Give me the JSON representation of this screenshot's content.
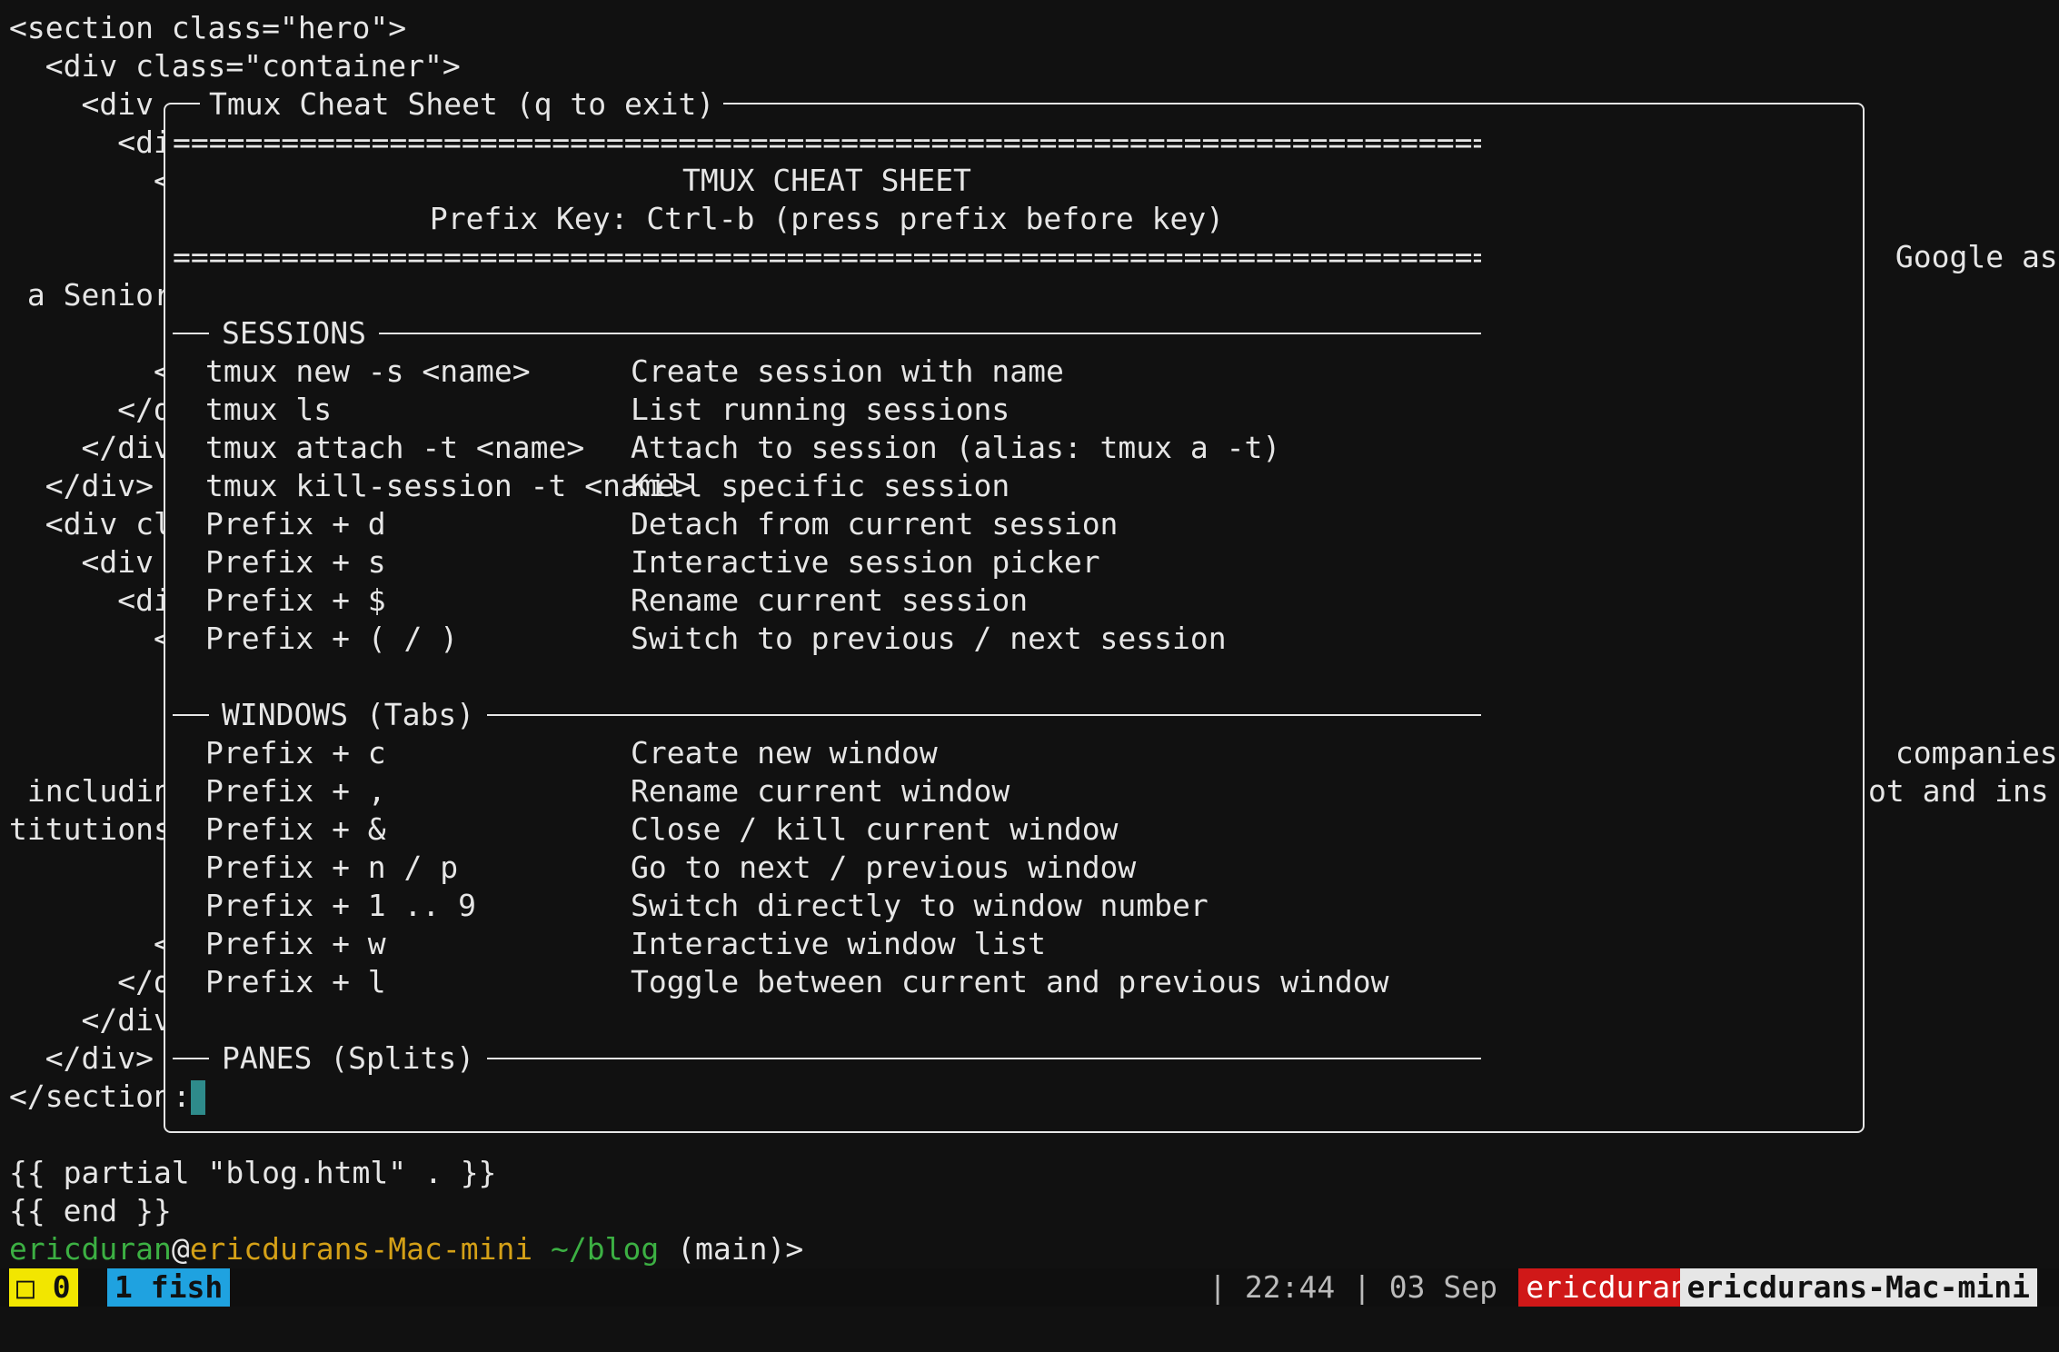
{
  "background_editor": {
    "lines_left": [
      "<section class=\"hero\">",
      "  <div class=\"container\">",
      "    <div",
      "      <di",
      "        <",
      "",
      "",
      " a Senior",
      "",
      "        <",
      "      </d",
      "    </div",
      "  </div> ",
      "  <div cl",
      "    <div ",
      "      <di",
      "        <",
      "",
      "",
      "",
      " includin",
      "titutions",
      "",
      "",
      "        <",
      "      </d",
      "    </div",
      "  </div> ",
      "</section"
    ],
    "right_google": " Google as",
    "right_companies": " companies",
    "right_ot": "ot and ins",
    "after_popup": [
      "{{ partial \"blog.html\" . }}",
      "{{ end }}"
    ]
  },
  "popup": {
    "title": "Tmux Cheat Sheet (q to exit)",
    "separator": "===================================================================================",
    "heading": "TMUX CHEAT SHEET",
    "prefix_line": "Prefix Key: Ctrl-b (press prefix before key)",
    "sections": [
      {
        "title": "SESSIONS",
        "rows": [
          {
            "cmd": "tmux new -s <name>",
            "desc": "Create session with name"
          },
          {
            "cmd": "tmux ls",
            "desc": "List running sessions"
          },
          {
            "cmd": "tmux attach -t <name>",
            "desc": "Attach to session (alias: tmux a -t)"
          },
          {
            "cmd": "tmux kill-session -t <name>",
            "desc": "Kill specific session"
          },
          {
            "cmd": "Prefix + d",
            "desc": "Detach from current session"
          },
          {
            "cmd": "Prefix + s",
            "desc": "Interactive session picker"
          },
          {
            "cmd": "Prefix + $",
            "desc": "Rename current session"
          },
          {
            "cmd": "Prefix + ( / )",
            "desc": "Switch to previous / next session"
          }
        ]
      },
      {
        "title": "WINDOWS (Tabs)",
        "rows": [
          {
            "cmd": "Prefix + c",
            "desc": "Create new window"
          },
          {
            "cmd": "Prefix + ,",
            "desc": "Rename current window"
          },
          {
            "cmd": "Prefix + &",
            "desc": "Close / kill current window"
          },
          {
            "cmd": "Prefix + n / p",
            "desc": "Go to next / previous window"
          },
          {
            "cmd": "Prefix + 1 .. 9",
            "desc": "Switch directly to window number"
          },
          {
            "cmd": "Prefix + w",
            "desc": "Interactive window list"
          },
          {
            "cmd": "Prefix + l",
            "desc": "Toggle between current and previous window"
          }
        ]
      },
      {
        "title": "PANES (Splits)",
        "rows": []
      }
    ],
    "command_prompt": ":"
  },
  "prompt": {
    "user": "ericduran",
    "at": "@",
    "host": "ericdurans-Mac-mini",
    "dir": " ~/blog",
    "branch": " (main)>"
  },
  "status_bar": {
    "session": "□ 0",
    "window": "1 fish",
    "time": "| 22:44 | 03 Sep",
    "user": "ericduran",
    "host": "ericdurans-Mac-mini"
  },
  "colors": {
    "background": "#111111",
    "foreground": "#e6e6e6",
    "prompt_green": "#3cb043",
    "prompt_host_yellow": "#d4a017",
    "session_yellow": "#f2e600",
    "window_blue": "#1fa2e0",
    "user_red": "#d01818",
    "cursor_teal": "#2e8b8b"
  }
}
